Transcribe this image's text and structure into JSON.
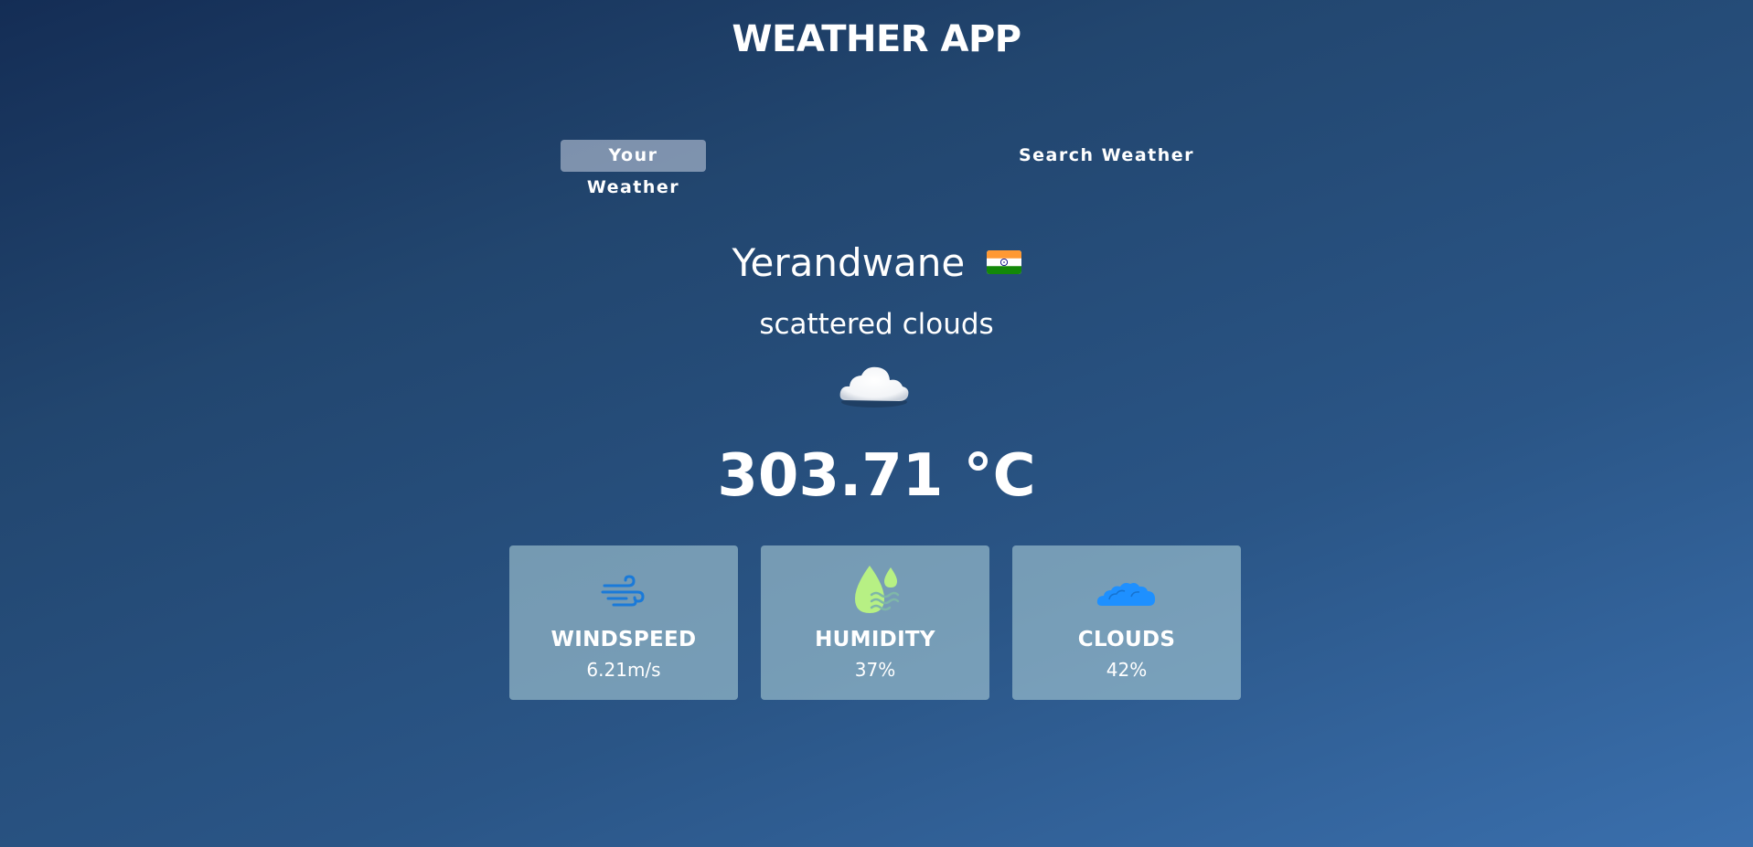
{
  "header": {
    "title": "WEATHER APP"
  },
  "tabs": [
    {
      "label": "Your Weather",
      "active": true
    },
    {
      "label": "Search Weather",
      "active": false
    }
  ],
  "location": {
    "city": "Yerandwane",
    "country_flag": "india-flag-icon"
  },
  "current": {
    "description": "scattered clouds",
    "icon": "scattered-clouds-icon",
    "temperature": "303.71 °C"
  },
  "stats": [
    {
      "label": "WINDSPEED",
      "value": "6.21m/s",
      "icon": "wind-icon"
    },
    {
      "label": "HUMIDITY",
      "value": "37%",
      "icon": "humidity-drop-icon"
    },
    {
      "label": "CLOUDS",
      "value": "42%",
      "icon": "clouds-icon"
    }
  ],
  "colors": {
    "background_start": "#142d55",
    "background_end": "#3a6fad",
    "active_tab": "#9ba9c0",
    "card": "#87acbe",
    "wind_icon": "#1a7ad9",
    "humidity_icon": "#b7f084",
    "clouds_icon": "#1e90ff"
  }
}
